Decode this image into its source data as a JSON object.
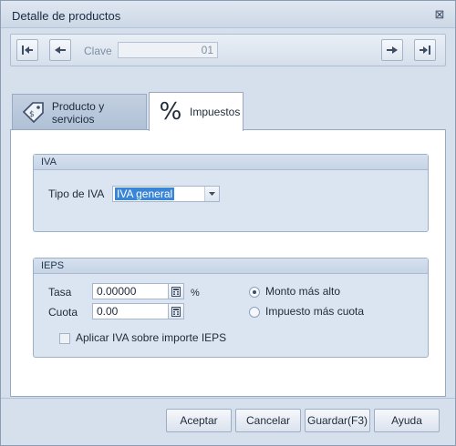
{
  "window": {
    "title": "Detalle de productos",
    "close_glyph": "⊠"
  },
  "toolbar": {
    "clave_label": "Clave",
    "clave_value": "01"
  },
  "tabs": [
    {
      "label": "Producto y servicios",
      "icon": "tag-icon",
      "active": false
    },
    {
      "label": "Impuestos",
      "icon": "percent-icon",
      "icon_text": "%",
      "active": true
    }
  ],
  "iva": {
    "group_title": "IVA",
    "tipo_label": "Tipo de IVA",
    "tipo_value": "IVA general"
  },
  "ieps": {
    "group_title": "IEPS",
    "tasa_label": "Tasa",
    "tasa_value": "0.00000",
    "tasa_unit": "%",
    "cuota_label": "Cuota",
    "cuota_value": "0.00",
    "radio_monto": "Monto más alto",
    "radio_impuesto": "Impuesto más cuota",
    "radio_selected": "monto",
    "aplicar_iva_label": "Aplicar IVA sobre importe IEPS",
    "aplicar_iva_checked": false
  },
  "buttons": {
    "aceptar": "Aceptar",
    "cancelar": "Cancelar",
    "guardar": "Guardar(F3)",
    "ayuda": "Ayuda"
  },
  "colors": {
    "window_bg": "#d6e0ec",
    "selection": "#3a86d6",
    "border": "#98aac2"
  }
}
